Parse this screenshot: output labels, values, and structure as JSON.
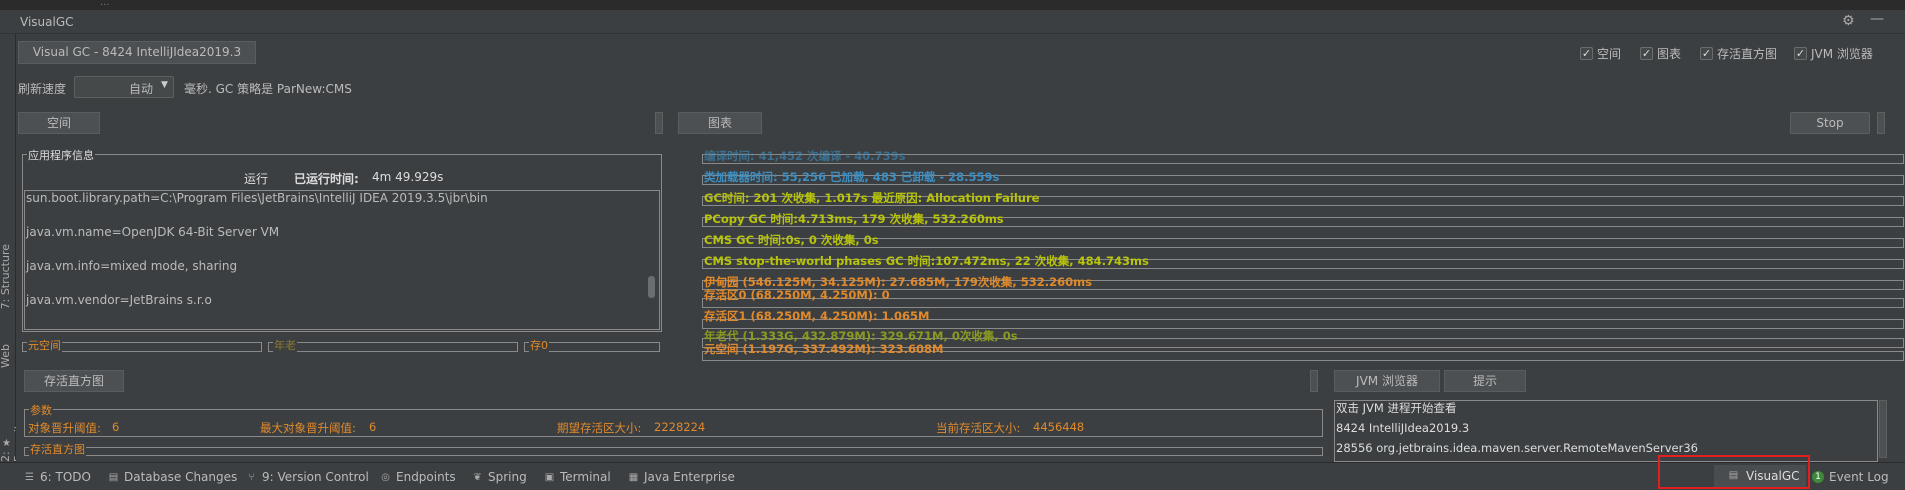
{
  "window": {
    "top_strip_text": "...",
    "title": "VisualGC",
    "settings_icon": "gear-icon",
    "minimize_icon": "minimize-icon"
  },
  "left_strip": {
    "structure": "7: Structure",
    "web": "Web",
    "favorites": "2: Favorites"
  },
  "header": {
    "process_tab": "Visual GC - 8424 IntelliJIdea2019.3",
    "checkboxes": [
      {
        "label": "空间",
        "checked": true
      },
      {
        "label": "图表",
        "checked": true
      },
      {
        "label": "存活直方图",
        "checked": true
      },
      {
        "label": "JVM 浏览器",
        "checked": true
      }
    ],
    "refresh_label": "刷新速度",
    "refresh_value": "自动",
    "gc_policy": "毫秒. GC 策略是 ParNew:CMS"
  },
  "space_panel": {
    "tab": "空间",
    "app_info_title": "应用程序信息",
    "status": "运行",
    "uptime_label": "已运行时间:",
    "uptime_value": "4m 49.929s",
    "properties": [
      "sun.boot.library.path=C:\\Program Files\\JetBrains\\IntelliJ IDEA 2019.3.5\\jbr\\bin",
      "java.vm.name=OpenJDK 64-Bit Server VM",
      "java.vm.info=mixed mode, sharing",
      "java.vm.vendor=JetBrains s.r.o"
    ],
    "regions": [
      "元空间",
      "年老",
      "存0"
    ]
  },
  "graph_panel": {
    "tab": "图表",
    "stop_button": "Stop",
    "rows": [
      {
        "text": "编译时间: 41,452 次编译 - 40.739s",
        "color": "blue"
      },
      {
        "text": "类加载器时间: 55,256 已加载, 483 已卸载 - 28.559s",
        "color": "blue"
      },
      {
        "text": "GC时间: 201 次收集, 1.017s  最近原因: Allocation Failure",
        "color": "yellow"
      },
      {
        "text": "PCopy GC 时间:4.713ms, 179 次收集, 532.260ms",
        "color": "yellow"
      },
      {
        "text": "CMS GC 时间:0s, 0 次收集, 0s",
        "color": "yellow"
      },
      {
        "text": "CMS stop-the-world phases GC 时间:107.472ms, 22 次收集, 484.743ms",
        "color": "yellow"
      },
      {
        "text": "伊甸园 (546.125M, 34.125M): 27.685M, 179次收集, 532.260ms",
        "color": "orange"
      },
      {
        "text": "存活区0 (68.250M, 4.250M): 0",
        "color": "orange"
      },
      {
        "text": "存活区1 (68.250M, 4.250M): 1.065M",
        "color": "orange"
      },
      {
        "text": "年老代 (1.333G, 432.879M): 329.671M, 0次收集, 0s",
        "color": "yellow"
      },
      {
        "text": "元空间 (1.197G, 337.492M): 323.608M",
        "color": "orange"
      }
    ]
  },
  "histogram_panel": {
    "tab": "存活直方图",
    "params_title": "参数",
    "params": [
      {
        "label": "对象晋升阈值:",
        "value": "6"
      },
      {
        "label": "最大对象晋升阈值:",
        "value": "6"
      },
      {
        "label": "期望存活区大小:",
        "value": "2228224"
      },
      {
        "label": "当前存活区大小:",
        "value": "4456448"
      }
    ],
    "histogram_title": "存活直方图"
  },
  "jvm_panel": {
    "tab_browser": "JVM 浏览器",
    "tab_hint": "提示",
    "hint": "双击 JVM 进程开始查看",
    "processes": [
      "8424 IntelliJIdea2019.3",
      "28556 org.jetbrains.idea.maven.server.RemoteMavenServer36"
    ]
  },
  "bottom_bar": {
    "items": [
      {
        "label": "6: TODO",
        "icon": "list-icon"
      },
      {
        "label": "Database Changes",
        "icon": "database-icon"
      },
      {
        "label": "9: Version Control",
        "icon": "branch-icon"
      },
      {
        "label": "Endpoints",
        "icon": "globe-icon"
      },
      {
        "label": "Spring",
        "icon": "leaf-icon"
      },
      {
        "label": "Terminal",
        "icon": "terminal-icon"
      },
      {
        "label": "Java Enterprise",
        "icon": "java-icon"
      }
    ],
    "visualgc": "VisualGC",
    "event_log_badge": "1",
    "event_log": "Event Log"
  },
  "colors": {
    "background": "#3c3f41",
    "orange": "#e08a2c",
    "blue": "#3d8ec2",
    "yellow": "#b8c40a",
    "highlight_red": "#e02020"
  }
}
